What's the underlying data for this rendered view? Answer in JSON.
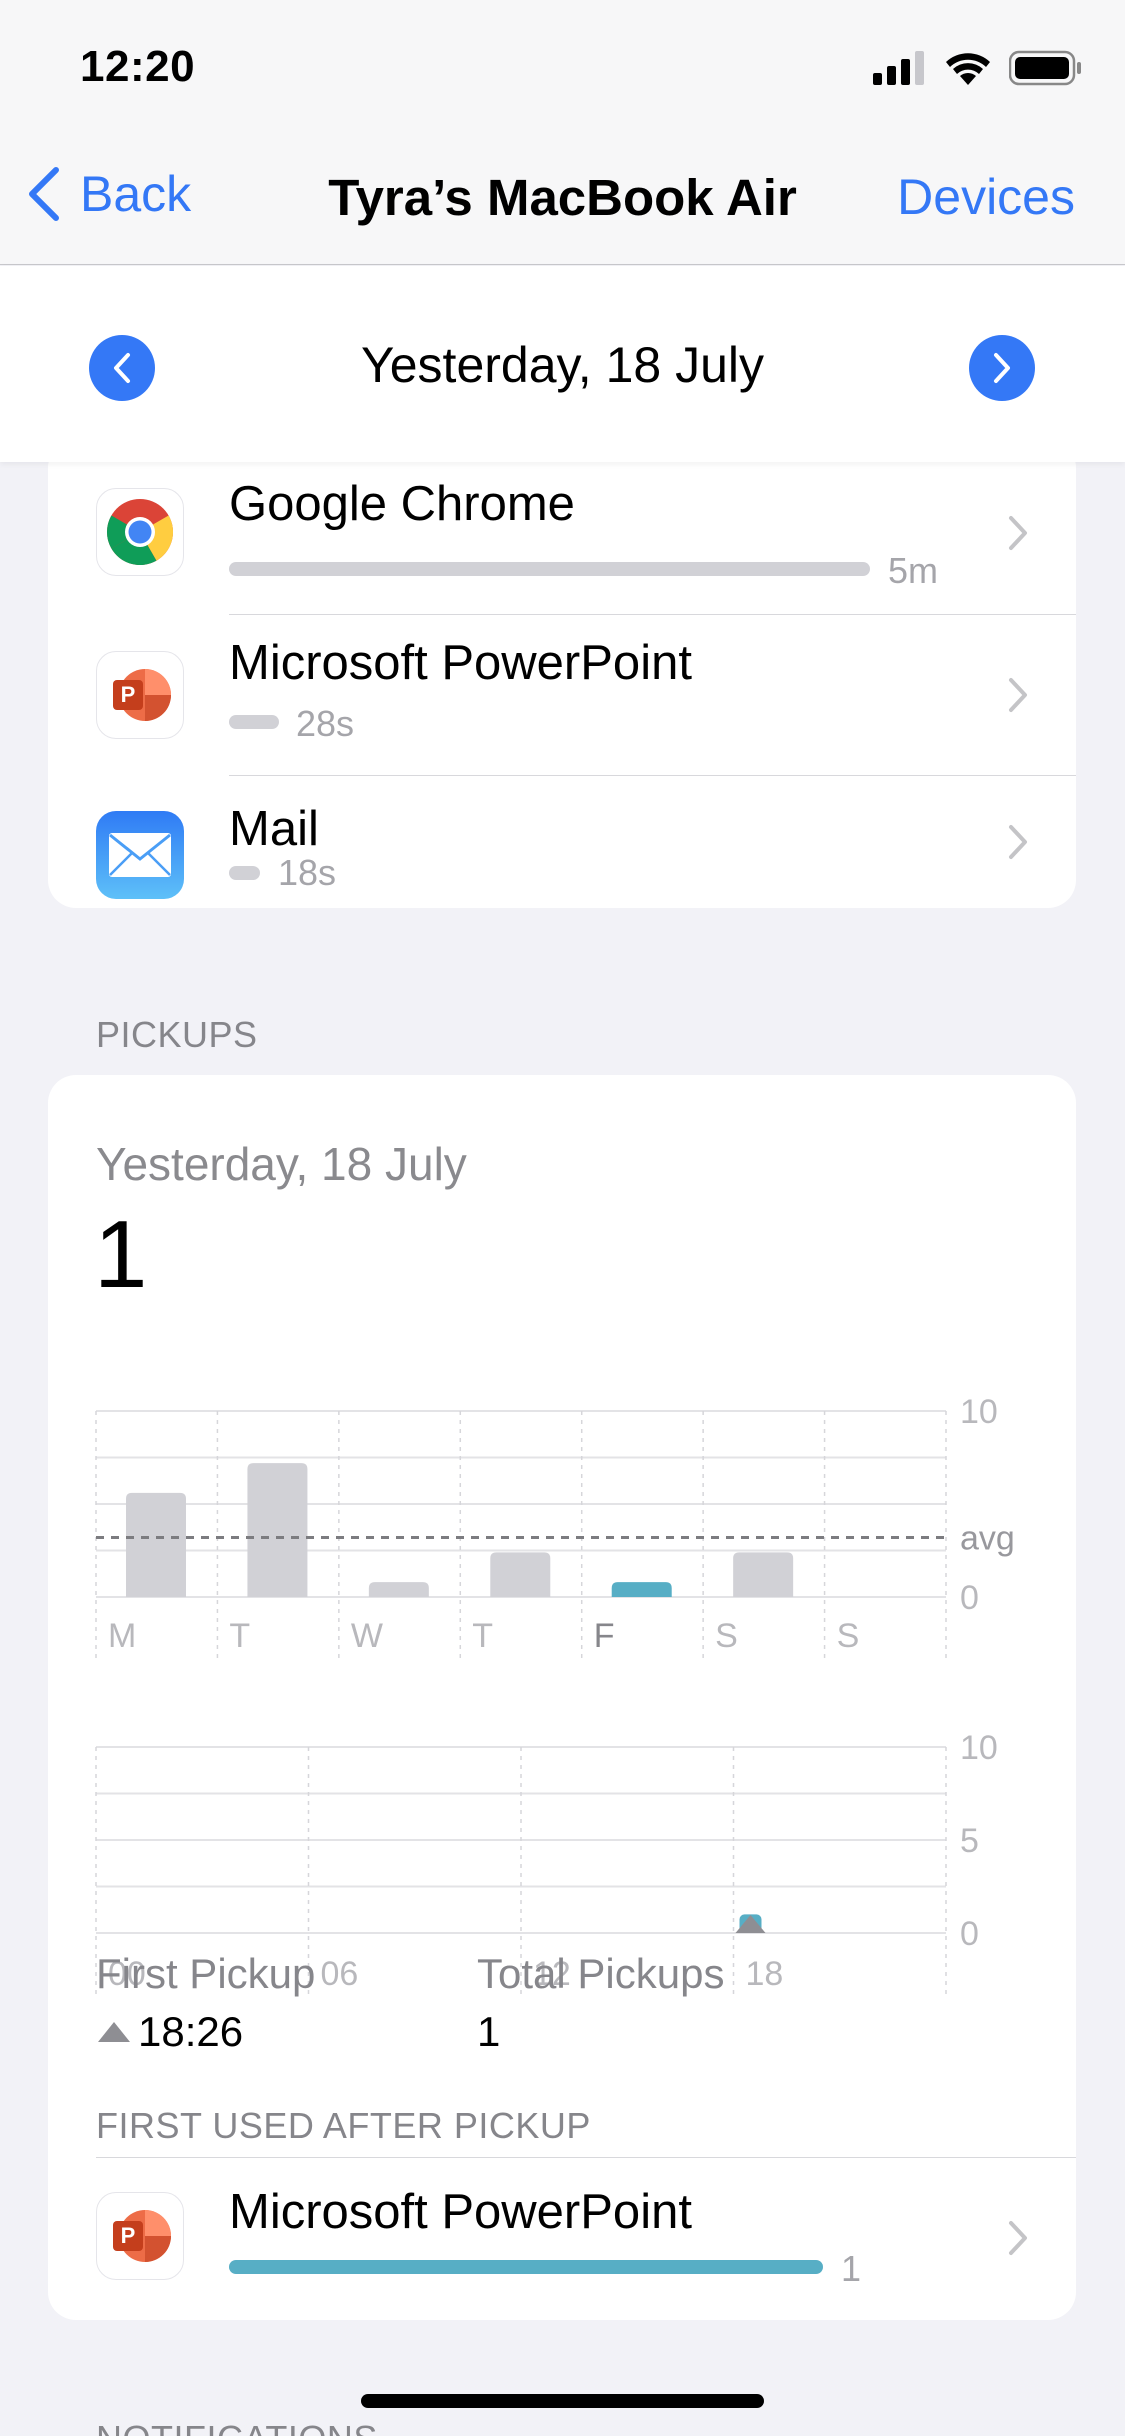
{
  "status_bar": {
    "time": "12:20"
  },
  "nav": {
    "back_label": "Back",
    "title": "Tyra’s MacBook Air",
    "right_label": "Devices"
  },
  "date_bar": {
    "label": "Yesterday, 18 July"
  },
  "apps": [
    {
      "name": "Google Chrome",
      "value": "5m",
      "icon": "chrome-icon",
      "bar_fraction": 1.0
    },
    {
      "name": "Microsoft PowerPoint",
      "value": "28s",
      "icon": "powerpoint-icon",
      "bar_fraction": 0.09
    },
    {
      "name": "Mail",
      "value": "18s",
      "icon": "mail-icon",
      "bar_fraction": 0.06
    }
  ],
  "pickups": {
    "section_title": "PICKUPS",
    "date": "Yesterday, 18 July",
    "count": "1",
    "first_pickup_label": "First Pickup",
    "first_pickup_value": "18:26",
    "total_label": "Total Pickups",
    "total_value": "1",
    "first_used_title": "FIRST USED AFTER PICKUP",
    "first_used_app": {
      "name": "Microsoft PowerPoint",
      "value": "1",
      "icon": "powerpoint-icon"
    }
  },
  "next_section_title": "NOTIFICATIONS",
  "colors": {
    "accent": "#3478f6",
    "highlight_bar": "#57aec5",
    "bar": "#d1d1d6"
  },
  "chart_data": [
    {
      "type": "bar",
      "categories": [
        "M",
        "T",
        "W",
        "T",
        "F",
        "S",
        "S"
      ],
      "values": [
        5.6,
        7.2,
        0.8,
        2.4,
        0.8,
        2.4,
        0
      ],
      "highlight_index": 4,
      "average_label": "avg",
      "average": 3.2,
      "ylim": [
        0,
        10
      ],
      "yticks": [
        "10",
        "0"
      ],
      "grid": true
    },
    {
      "type": "bar",
      "categories": [
        "00",
        "06",
        "12",
        "18"
      ],
      "hours": [
        18
      ],
      "values": [
        1
      ],
      "ylim": [
        0,
        10
      ],
      "yticks": [
        "10",
        "5",
        "0"
      ],
      "marker_hour": 18,
      "grid": true
    }
  ]
}
